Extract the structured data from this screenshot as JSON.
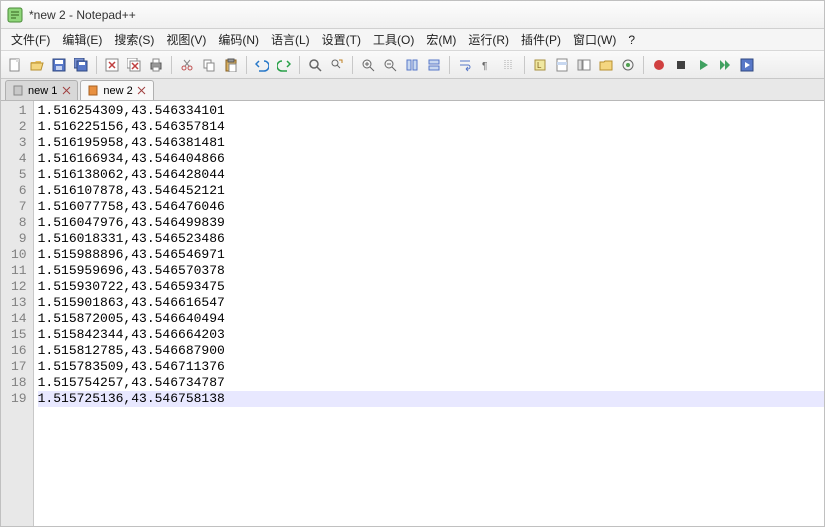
{
  "window": {
    "title": "*new 2 - Notepad++"
  },
  "menu": {
    "file": "文件(F)",
    "edit": "编辑(E)",
    "search": "搜索(S)",
    "view": "视图(V)",
    "encoding": "编码(N)",
    "language": "语言(L)",
    "settings": "设置(T)",
    "tools": "工具(O)",
    "macro": "宏(M)",
    "run": "运行(R)",
    "plugins": "插件(P)",
    "window": "窗口(W)",
    "help": "?"
  },
  "tabs": {
    "tab1": {
      "label": "new 1"
    },
    "tab2": {
      "label": "new 2"
    }
  },
  "lines": {
    "l1": "1.516254309,43.546334101",
    "l2": "1.516225156,43.546357814",
    "l3": "1.516195958,43.546381481",
    "l4": "1.516166934,43.546404866",
    "l5": "1.516138062,43.546428044",
    "l6": "1.516107878,43.546452121",
    "l7": "1.516077758,43.546476046",
    "l8": "1.516047976,43.546499839",
    "l9": "1.516018331,43.546523486",
    "l10": "1.515988896,43.546546971",
    "l11": "1.515959696,43.546570378",
    "l12": "1.515930722,43.546593475",
    "l13": "1.515901863,43.546616547",
    "l14": "1.515872005,43.546640494",
    "l15": "1.515842344,43.546664203",
    "l16": "1.515812785,43.546687900",
    "l17": "1.515783509,43.546711376",
    "l18": "1.515754257,43.546734787",
    "l19": "1.515725136,43.546758138"
  },
  "lineNumbers": {
    "n1": "1",
    "n2": "2",
    "n3": "3",
    "n4": "4",
    "n5": "5",
    "n6": "6",
    "n7": "7",
    "n8": "8",
    "n9": "9",
    "n10": "10",
    "n11": "11",
    "n12": "12",
    "n13": "13",
    "n14": "14",
    "n15": "15",
    "n16": "16",
    "n17": "17",
    "n18": "18",
    "n19": "19"
  }
}
